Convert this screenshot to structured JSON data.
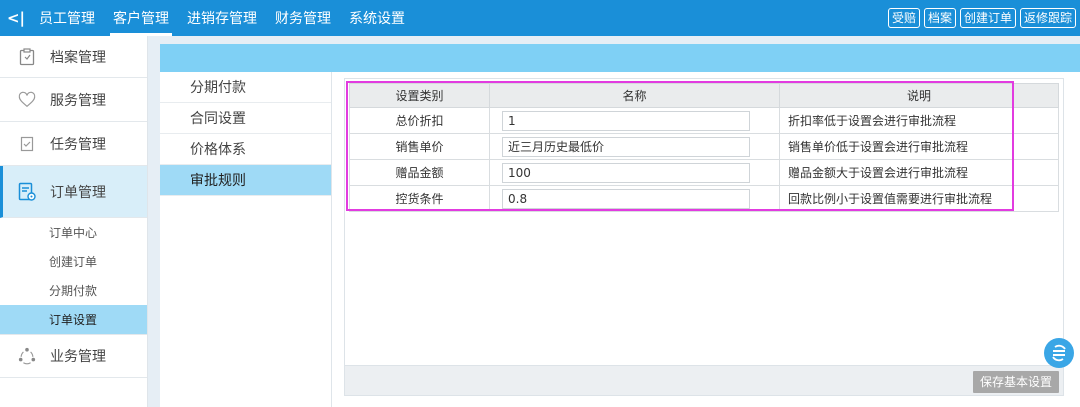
{
  "topbar": {
    "collapse_glyph": "<|",
    "nav": [
      "员工管理",
      "客户管理",
      "进销存管理",
      "财务管理",
      "系统设置"
    ],
    "actions": [
      "受赔",
      "档案",
      "创建订单",
      "返修跟踪"
    ]
  },
  "sidebar": {
    "items": [
      {
        "label": "档案管理",
        "icon": "clipboard-icon"
      },
      {
        "label": "服务管理",
        "icon": "heart-icon"
      },
      {
        "label": "任务管理",
        "icon": "task-icon"
      },
      {
        "label": "订单管理",
        "icon": "order-icon"
      }
    ],
    "subitems": [
      "订单中心",
      "创建订单",
      "分期付款",
      "订单设置"
    ],
    "last": {
      "label": "业务管理",
      "icon": "business-icon"
    }
  },
  "submenu": [
    "分期付款",
    "合同设置",
    "价格体系",
    "审批规则"
  ],
  "table": {
    "headers": [
      "设置类别",
      "名称",
      "说明"
    ],
    "rows": [
      {
        "category": "总价折扣",
        "value": "1",
        "desc": "折扣率低于设置会进行审批流程"
      },
      {
        "category": "销售单价",
        "value": "近三月历史最低价",
        "desc": "销售单价低于设置会进行审批流程"
      },
      {
        "category": "赠品金额",
        "value": "100",
        "desc": "赠品金额大于设置会进行审批流程"
      },
      {
        "category": "控货条件",
        "value": "0.8",
        "desc": "回款比例小于设置值需要进行审批流程"
      }
    ]
  },
  "footer": {
    "save_label": "保存基本设置"
  },
  "colors": {
    "accent": "#1a8fd8",
    "highlight": "#e23be0",
    "active_bg": "#9fdaf6"
  }
}
